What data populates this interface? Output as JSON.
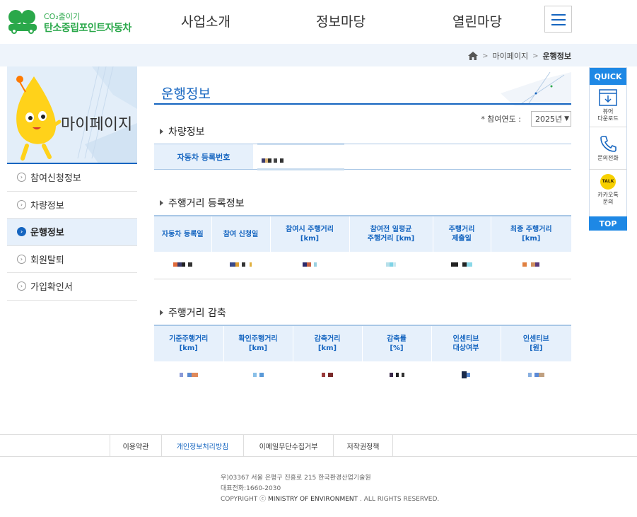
{
  "header": {
    "logo_small": "CO₂줄이기",
    "logo_big": "탄소중립포인트자동차",
    "nav": [
      "사업소개",
      "정보마당",
      "열린마당"
    ]
  },
  "breadcrumb": {
    "items": [
      "마이페이지",
      "운행정보"
    ]
  },
  "sidebar": {
    "title": "마이페이지",
    "items": [
      {
        "label": "참여신청정보",
        "active": false
      },
      {
        "label": "차량정보",
        "active": false
      },
      {
        "label": "운행정보",
        "active": true
      },
      {
        "label": "회원탈퇴",
        "active": false
      },
      {
        "label": "가입확인서",
        "active": false
      }
    ]
  },
  "main": {
    "title": "운행정보",
    "year_label": "* 참여연도 :",
    "year_value": "2025년",
    "vehicle": {
      "section_title": "차량정보",
      "reg_label": "자동차 등록번호"
    },
    "mileage_reg": {
      "section_title": "주행거리 등록정보",
      "headers": [
        "자동차 등록일",
        "참여 신청일",
        "참여시 주행거리\n[km]",
        "참여전 일평균\n주행거리 [km]",
        "주행거리\n제출일",
        "최종 주행거리\n[km]"
      ]
    },
    "mileage_reduce": {
      "section_title": "주행거리 감축",
      "headers": [
        "기준주행거리\n[km]",
        "확인주행거리\n[km]",
        "감축거리\n[km]",
        "감축률\n[%]",
        "인센티브\n대상여부",
        "인센티브\n[원]"
      ]
    }
  },
  "quick": {
    "title": "QUICK",
    "items": [
      {
        "label": "뷰어\n다운로드",
        "icon": "download-icon"
      },
      {
        "label": "문의전화",
        "icon": "phone-icon"
      },
      {
        "label": "카카오톡\n문의",
        "icon": "kakao-talk-icon",
        "badge": "TALK"
      }
    ],
    "top_label": "TOP"
  },
  "footer": {
    "links": [
      "이용약관",
      "개인정보처리방침",
      "이메일무단수집거부",
      "저작권정책"
    ],
    "address": "우)03367 서울 은평구 진흥로 215 한국환경산업기술원",
    "phone": "대표전화:1660-2030",
    "copyright_prefix": "COPYRIGHT ⓒ",
    "copyright_org": "MINISTRY OF ENVIRONMENT",
    "copyright_suffix": ". ALL RIGHTS RESERVED."
  },
  "colors": {
    "primary": "#1565c0",
    "quick": "#1e88e5",
    "logo_green": "#2aa84a",
    "header_bg": "#e6f0fb"
  }
}
